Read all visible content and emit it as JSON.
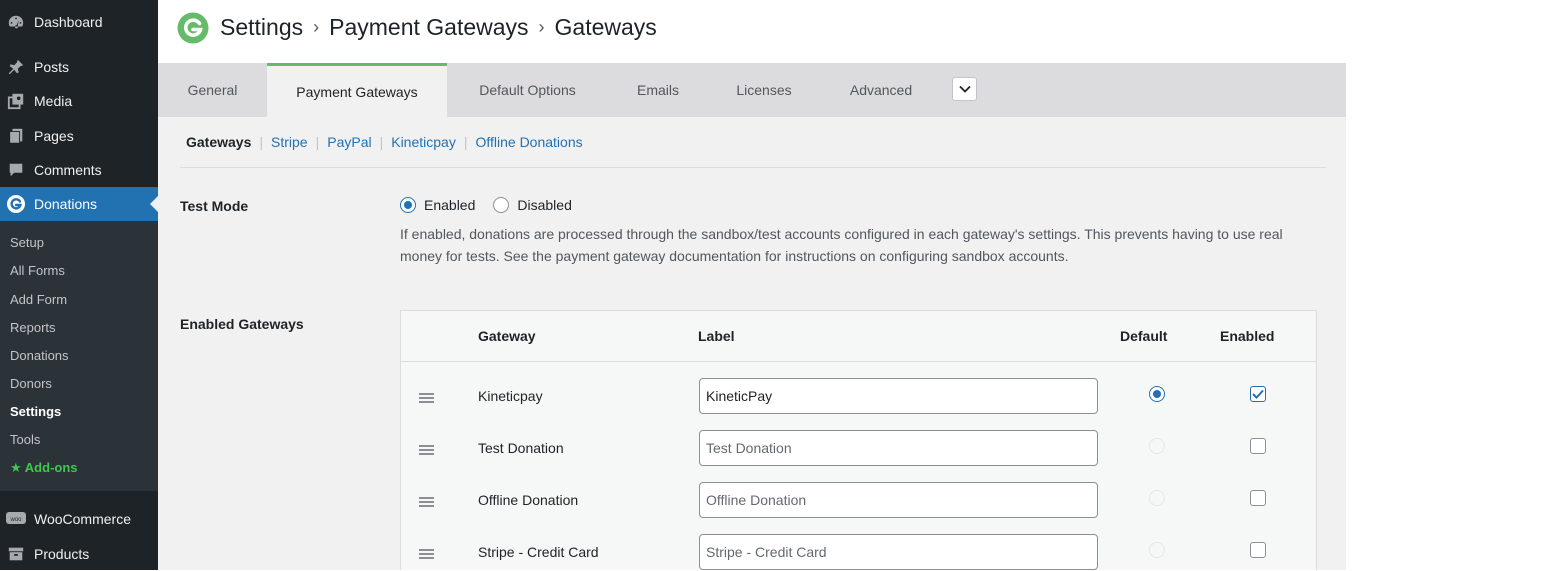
{
  "sidebar": {
    "top_items": [
      {
        "label": "Dashboard",
        "icon": "dashboard-icon"
      },
      {
        "label": "Posts",
        "icon": "pin-icon"
      },
      {
        "label": "Media",
        "icon": "media-icon"
      },
      {
        "label": "Pages",
        "icon": "pages-icon"
      },
      {
        "label": "Comments",
        "icon": "comment-icon"
      },
      {
        "label": "Donations",
        "icon": "givewp-icon",
        "active": true
      }
    ],
    "submenu": [
      "Setup",
      "All Forms",
      "Add Form",
      "Reports",
      "Donations",
      "Donors",
      "Settings",
      "Tools",
      "Add-ons"
    ],
    "submenu_current": "Settings",
    "bottom_items": [
      {
        "label": "WooCommerce",
        "icon": "woo-icon"
      },
      {
        "label": "Products",
        "icon": "archive-icon"
      }
    ],
    "colors": {
      "bg": "#1d2327",
      "submenu_bg": "#2c3338",
      "active": "#2271b1",
      "addons": "#3ec84e"
    }
  },
  "header": {
    "breadcrumb": [
      "Settings",
      "Payment Gateways",
      "Gateways"
    ],
    "logo_color": "#66bb6a"
  },
  "tabs": {
    "items": [
      "General",
      "Payment Gateways",
      "Default Options",
      "Emails",
      "Licenses",
      "Advanced"
    ],
    "active": "Payment Gateways",
    "more_icon": "chevron-down-icon"
  },
  "subnav": {
    "current": "Gateways",
    "links": [
      "Stripe",
      "PayPal",
      "Kineticpay",
      "Offline Donations"
    ]
  },
  "test_mode": {
    "label": "Test Mode",
    "options": [
      "Enabled",
      "Disabled"
    ],
    "selected": "Enabled",
    "description": "If enabled, donations are processed through the sandbox/test accounts configured in each gateway's settings. This prevents having to use real money for tests. See the payment gateway documentation for instructions on configuring sandbox accounts."
  },
  "enabled_gateways": {
    "label": "Enabled Gateways",
    "columns": {
      "gateway": "Gateway",
      "label": "Label",
      "default": "Default",
      "enabled": "Enabled"
    },
    "rows": [
      {
        "gateway": "Kineticpay",
        "label_value": "KineticPay",
        "label_placeholder": "",
        "default": true,
        "enabled": true
      },
      {
        "gateway": "Test Donation",
        "label_value": "",
        "label_placeholder": "Test Donation",
        "default": false,
        "enabled": false
      },
      {
        "gateway": "Offline Donation",
        "label_value": "",
        "label_placeholder": "Offline Donation",
        "default": false,
        "enabled": false
      },
      {
        "gateway": "Stripe - Credit Card",
        "label_value": "",
        "label_placeholder": "Stripe - Credit Card",
        "default": false,
        "enabled": false
      }
    ]
  }
}
